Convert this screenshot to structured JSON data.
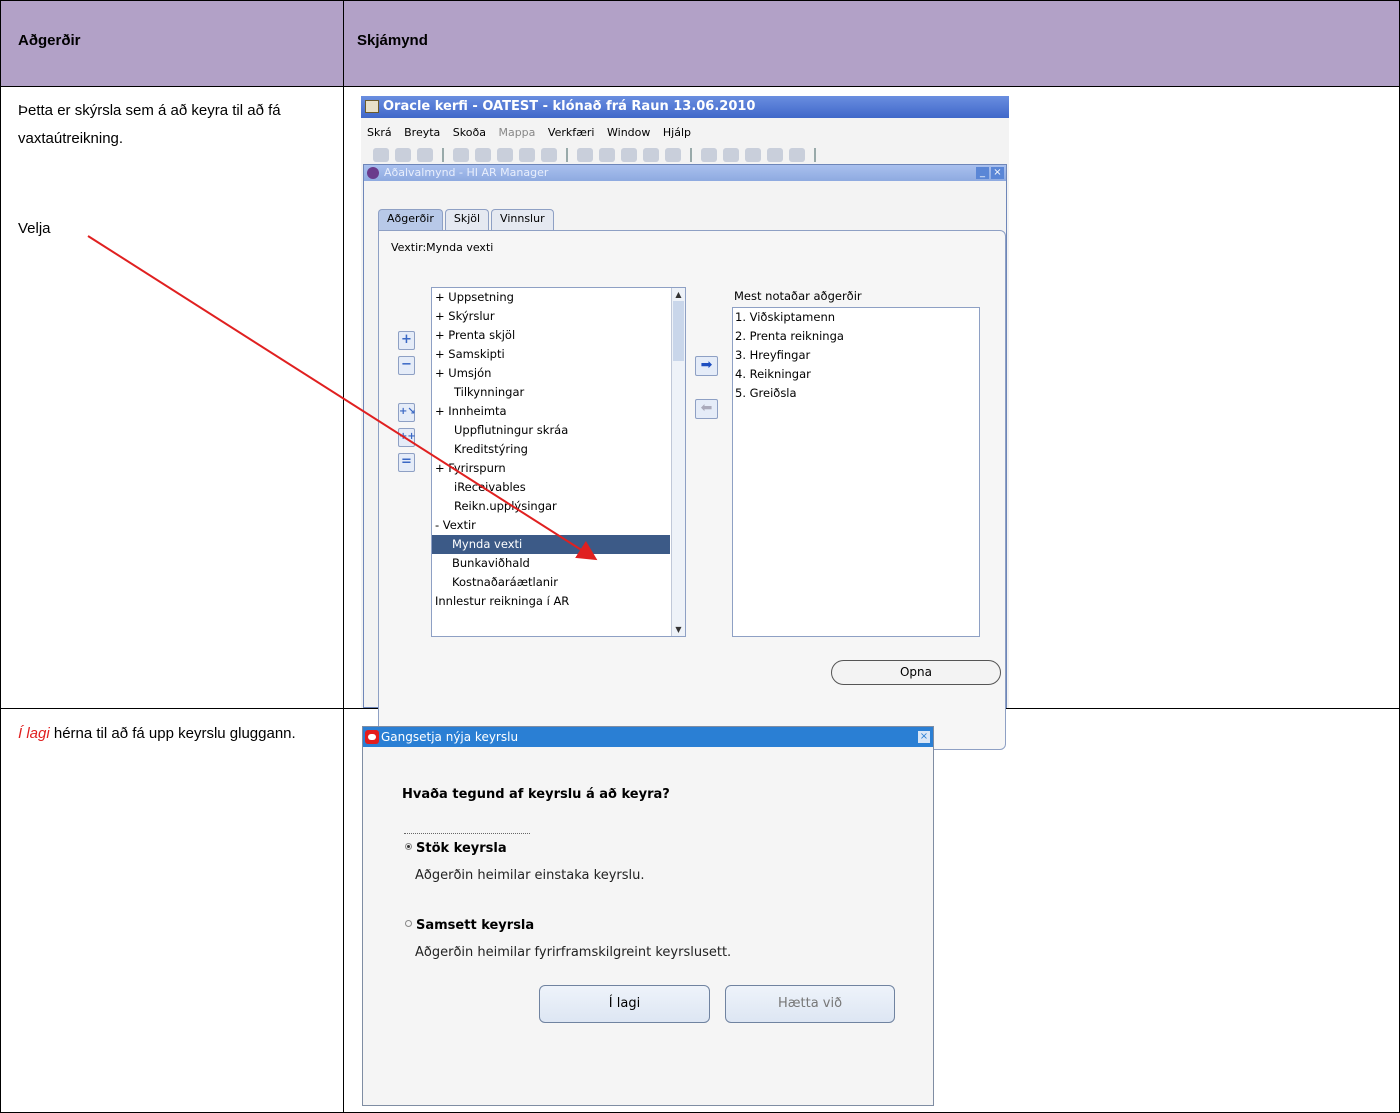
{
  "table": {
    "headers": [
      "Aðgerðir",
      "Skjámynd"
    ],
    "row1": {
      "instruction": "Þetta er skýrsla sem á að keyra til að fá vaxtaútreikning.",
      "select_label": "Velja"
    },
    "row2": {
      "emphasis": "Í lagi",
      "instruction": " hérna til að fá upp keyrslu gluggann."
    }
  },
  "oracle_window": {
    "title": "Oracle kerfi - OATEST - klónað frá Raun 13.06.2010",
    "menu": [
      "Skrá",
      "Breyta",
      "Skoða",
      "Mappa",
      "Verkfæri",
      "Window",
      "Hjálp"
    ],
    "inner_title": "Aðalvalmynd - HI AR Manager",
    "tabs": [
      "Aðgerðir",
      "Skjöl",
      "Vinnslur"
    ],
    "current_path": "Vextir:Mynda vexti",
    "tree_items": [
      "+ Uppsetning",
      "+ Skýrslur",
      "+ Prenta skjöl",
      "+ Samskipti",
      "+ Umsjón",
      "Tilkynningar",
      "+ Innheimta",
      "Uppflutningur skráa",
      "Kreditstýring",
      "+ Fyrirspurn",
      "iReceivables",
      "Reikn.upplýsingar",
      "- Vextir",
      "Mynda vexti",
      "Bunkaviðhald",
      "Kostnaðaráætlanir",
      "Innlestur reikninga í AR"
    ],
    "selected_item": "Mynda vexti",
    "most_used_label": "Mest notaðar aðgerðir",
    "most_used": [
      "1. Viðskiptamenn",
      "2. Prenta reikninga",
      "3. Hreyfingar",
      "4. Reikningar",
      "5. Greiðsla"
    ],
    "open_button": "Opna"
  },
  "dialog": {
    "title": "Gangsetja nýja keyrslu",
    "question": "Hvaða tegund af keyrslu á að keyra?",
    "option1_label": "Stök keyrsla",
    "option1_desc": "Aðgerðin heimilar einstaka keyrslu.",
    "option2_label": "Samsett keyrsla",
    "option2_desc": "Aðgerðin heimilar fyrirframskilgreint keyrslusett.",
    "ok_button": "Í lagi",
    "cancel_button": "Hætta við",
    "selected_option": "Stök keyrsla"
  },
  "colors": {
    "header_bg": "#b2a1c7",
    "arrow": "#e02020",
    "selection": "#3c5a87",
    "dialog_title": "#2a7fd4"
  }
}
